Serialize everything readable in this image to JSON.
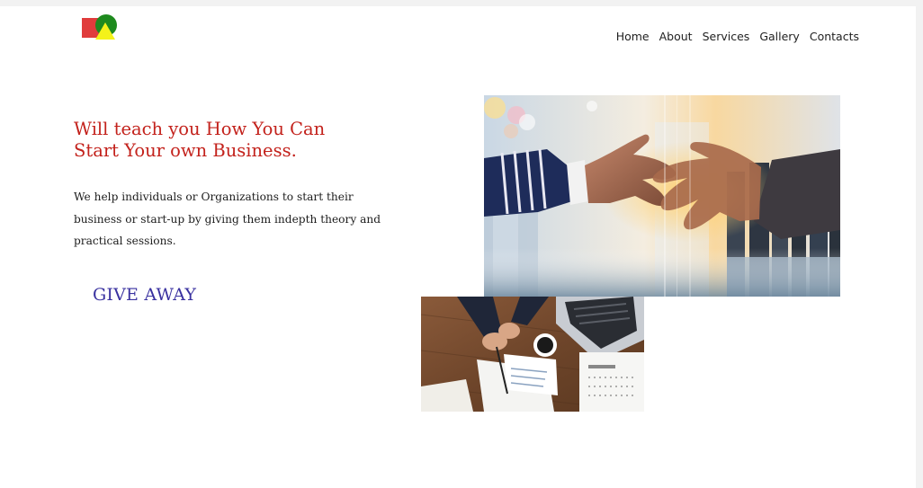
{
  "header": {
    "logo_icon": "geometric-shapes-logo",
    "nav": {
      "items": [
        "Home",
        "About",
        "Services",
        "Gallery",
        "Contacts"
      ]
    }
  },
  "hero": {
    "title_line1": "Will teach you How You Can",
    "title_line2": "Start Your own Business.",
    "description_line1": "We help individuals or Organizations to start their",
    "description_line2": "business or start-up by giving them indepth theory and",
    "description_line3": "practical sessions.",
    "cta_label": "GIVE AWAY"
  },
  "colors": {
    "title": "#c3221c",
    "cta": "#3a32a0",
    "logo_red": "#e03c3c",
    "logo_green": "#1e8a1e",
    "logo_yellow": "#f4f21a"
  },
  "images": {
    "top": "handshake-city-photo",
    "bottom": "office-desk-documents-photo"
  }
}
